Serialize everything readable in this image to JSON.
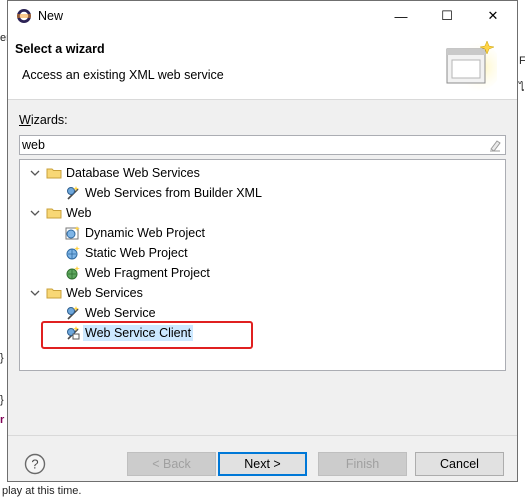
{
  "window": {
    "title": "New",
    "minimize": "—",
    "maximize": "☐",
    "close": "✕"
  },
  "banner": {
    "heading": "Select a wizard",
    "description": "Access an existing XML web service"
  },
  "wizards_label_prefix": "W",
  "wizards_label_rest": "izards:",
  "filter": {
    "value": "web"
  },
  "tree": [
    {
      "label": "Database Web Services",
      "kind": "folder"
    },
    {
      "label": "Web Services from Builder XML",
      "kind": "item"
    },
    {
      "label": "Web",
      "kind": "folder"
    },
    {
      "label": "Dynamic Web Project",
      "kind": "item"
    },
    {
      "label": "Static Web Project",
      "kind": "item"
    },
    {
      "label": "Web Fragment Project",
      "kind": "item"
    },
    {
      "label": "Web Services",
      "kind": "folder"
    },
    {
      "label": "Web Service",
      "kind": "item"
    },
    {
      "label": "Web Service Client",
      "kind": "item",
      "selected": true
    }
  ],
  "buttons": {
    "back": "< Back",
    "next": "Next >",
    "finish": "Finish",
    "cancel": "Cancel"
  },
  "background": {
    "left_1": "er",
    "left_2": "}",
    "left_3": "}",
    "left_4": "r",
    "right_1": "F",
    "right_2": "ไ",
    "bottom": "play at this time."
  },
  "colors": {
    "accent": "#0078d7",
    "selection": "#cce8ff",
    "highlight": "#e02020"
  }
}
